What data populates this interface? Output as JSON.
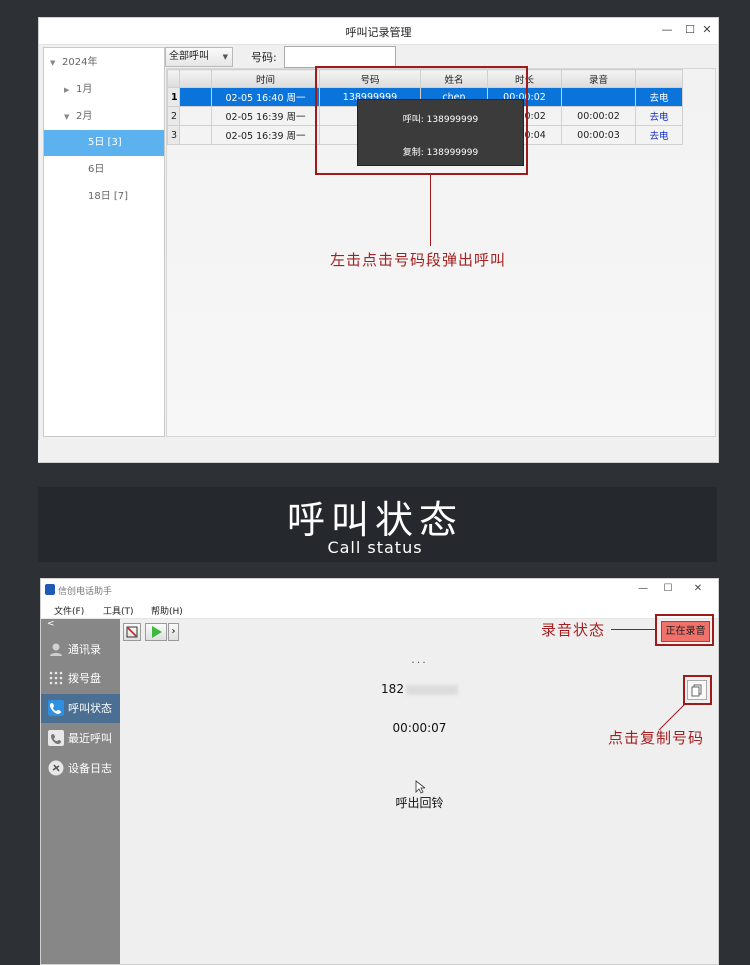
{
  "top_window": {
    "title": "呼叫记录管理",
    "controls": [
      "—",
      "☐",
      "✕"
    ],
    "tree": [
      {
        "label": "2024年",
        "expanded": true
      },
      {
        "label": "1月",
        "expanded": false
      },
      {
        "label": "2月",
        "expanded": true
      },
      {
        "label": "5日 [3]",
        "selected": true
      },
      {
        "label": "6日"
      },
      {
        "label": "18日 [7]"
      }
    ],
    "filter": {
      "value": "全部呼叫",
      "number_label": "号码:",
      "number_value": ""
    },
    "columns": [
      "",
      "时间",
      "号码",
      "姓名",
      "时长",
      "录音",
      ""
    ],
    "rows": [
      {
        "n": "1",
        "time": "02-05 16:40 周一",
        "number": "138999999",
        "name": "chen",
        "duration": "00:00:02",
        "recording": "",
        "action": "去电"
      },
      {
        "n": "2",
        "time": "02-05 16:39 周一",
        "number": "",
        "name": "",
        "duration": "00:00:02",
        "recording": "00:00:02",
        "action": "去电"
      },
      {
        "n": "3",
        "time": "02-05 16:39 周一",
        "number": "",
        "name": "",
        "duration": "00:00:04",
        "recording": "00:00:03",
        "action": "去电"
      }
    ],
    "popup": {
      "call": "呼叫: 138999999",
      "copy": "复制: 138999999"
    },
    "callout": "左击点击号码段弹出呼叫"
  },
  "banner": {
    "title_cn": "呼叫状态",
    "title_en": "Call status"
  },
  "bottom_window": {
    "title": "信创电话助手",
    "controls": [
      "—",
      "☐",
      "✕"
    ],
    "menu": [
      "文件(F)",
      "工具(T)",
      "帮助(H)"
    ],
    "collapse_label": "<",
    "sidebar": [
      {
        "label": "通讯录",
        "icon": "contacts-icon"
      },
      {
        "label": "拨号盘",
        "icon": "dialpad-icon"
      },
      {
        "label": "呼叫状态",
        "icon": "phone-status-icon",
        "selected": true
      },
      {
        "label": "最近呼叫",
        "icon": "recent-calls-icon"
      },
      {
        "label": "设备日志",
        "icon": "device-log-icon"
      }
    ],
    "dots": "...",
    "number_prefix": "182",
    "timer": "00:00:07",
    "status": "呼出回铃",
    "recording_badge": "正在录音",
    "callout_recording": "录音状态",
    "callout_copy": "点击复制号码"
  },
  "colors": {
    "accent_red": "#9e1b1b",
    "selected_blue": "#0a74da",
    "sidebar_gray": "#878787",
    "sidebar_selected": "#4a6f92",
    "badge_red": "#f0706a"
  }
}
